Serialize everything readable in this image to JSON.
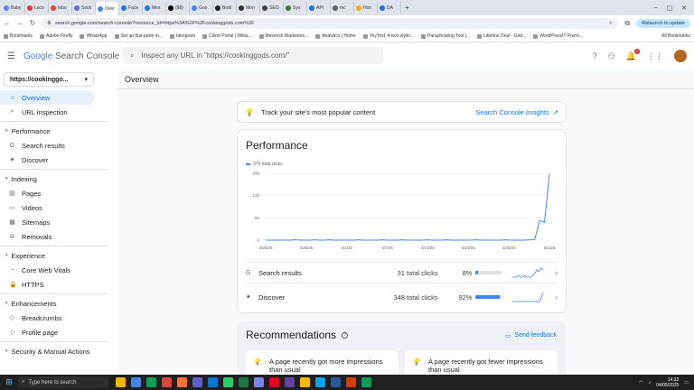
{
  "browser": {
    "tabs": [
      {
        "label": "Baby",
        "color": "#6b7ef5"
      },
      {
        "label": "Loco",
        "color": "#e53935"
      },
      {
        "label": "Inbo",
        "color": "#ea4335"
      },
      {
        "label": "Sock",
        "color": "#5b6ee1"
      },
      {
        "label": "Over",
        "color": "#4285f4",
        "active": true
      },
      {
        "label": "Face",
        "color": "#1877f2"
      },
      {
        "label": "Mes",
        "color": "#1877f2"
      },
      {
        "label": "(98)",
        "color": "#000000"
      },
      {
        "label": "Goo",
        "color": "#4285f4"
      },
      {
        "label": "Bodi",
        "color": "#222222"
      },
      {
        "label": "Mon",
        "color": "#333333"
      },
      {
        "label": "SEO",
        "color": "#444444"
      },
      {
        "label": "Sys",
        "color": "#2e7d32"
      },
      {
        "label": "API",
        "color": "#1a73e8"
      },
      {
        "label": "mc",
        "color": "#5f6368"
      },
      {
        "label": "Hon",
        "color": "#f9ab00"
      },
      {
        "label": "DA",
        "color": "#1a73e8"
      }
    ],
    "url": "search.google.com/search-console?resource_id=https%3A%2F%2Fcookinggods.com%2F",
    "relaunch": "Relaunch to update",
    "bookmarks": [
      "Bookmarks",
      "Adobe Firefly",
      "WhatsApp",
      "Set up first-party m...",
      "Ideogram",
      "Client Portal | Willia...",
      "Maverick Marketers...",
      "Analytics | Home",
      "YeyText: A text stylin...",
      "Paraphrasing Tool |...",
      "Lifetime Deal - Grid...",
      "WordPressIT Premi..."
    ],
    "all_bookmarks": "All Bookmarks"
  },
  "header": {
    "logo_google": "Google",
    "logo_product": "Search Console",
    "inspect_placeholder": "Inspect any URL in \"https://cookinggods.com/\"",
    "notif_count": "1"
  },
  "sidebar": {
    "property": "https://cookinggo...",
    "items": [
      {
        "type": "item",
        "label": "Overview",
        "icon": "⌂",
        "active": true,
        "name": "sidebar-item-overview"
      },
      {
        "type": "item",
        "label": "URL inspection",
        "icon": "⌕",
        "name": "sidebar-item-url-inspection"
      },
      {
        "type": "divider"
      },
      {
        "type": "section",
        "label": "Performance",
        "name": "sidebar-section-performance"
      },
      {
        "type": "item",
        "label": "Search results",
        "icon": "G",
        "name": "sidebar-item-search-results"
      },
      {
        "type": "item",
        "label": "Discover",
        "icon": "✷",
        "name": "sidebar-item-discover"
      },
      {
        "type": "divider"
      },
      {
        "type": "section",
        "label": "Indexing",
        "name": "sidebar-section-indexing"
      },
      {
        "type": "item",
        "label": "Pages",
        "icon": "▤",
        "name": "sidebar-item-pages"
      },
      {
        "type": "item",
        "label": "Videos",
        "icon": "▭",
        "name": "sidebar-item-videos"
      },
      {
        "type": "item",
        "label": "Sitemaps",
        "icon": "▦",
        "name": "sidebar-item-sitemaps"
      },
      {
        "type": "item",
        "label": "Removals",
        "icon": "⊘",
        "name": "sidebar-item-removals"
      },
      {
        "type": "divider"
      },
      {
        "type": "section",
        "label": "Experience",
        "name": "sidebar-section-experience"
      },
      {
        "type": "item",
        "label": "Core Web Vitals",
        "icon": "◔",
        "name": "sidebar-item-core-web-vitals"
      },
      {
        "type": "item",
        "label": "HTTPS",
        "icon": "🔒",
        "name": "sidebar-item-https"
      },
      {
        "type": "divider"
      },
      {
        "type": "section",
        "label": "Enhancements",
        "name": "sidebar-section-enhancements"
      },
      {
        "type": "item",
        "label": "Breadcrumbs",
        "icon": "◇",
        "name": "sidebar-item-breadcrumbs"
      },
      {
        "type": "item",
        "label": "Profile page",
        "icon": "◇",
        "name": "sidebar-item-profile-page"
      },
      {
        "type": "divider"
      },
      {
        "type": "section",
        "label": "Security & Manual Actions",
        "name": "sidebar-section-security"
      }
    ]
  },
  "main": {
    "title": "Overview",
    "insights": {
      "text": "Track your site's most popular content",
      "link": "Search Console Insights"
    },
    "performance": {
      "title": "Performance",
      "legend": "379 total clicks",
      "rows": [
        {
          "icon": "G",
          "name": "Search results",
          "clicks": "31 total clicks",
          "pct": "8%",
          "fraction": 0.08,
          "spark": [
            0,
            0,
            0,
            1,
            0,
            0,
            1,
            0,
            0,
            0,
            1,
            2,
            4,
            3,
            5,
            4
          ]
        },
        {
          "icon": "✷",
          "name": "Discover",
          "clicks": "348 total clicks",
          "pct": "92%",
          "fraction": 0.92,
          "spark": [
            0,
            0,
            0,
            0,
            0,
            0,
            0,
            0,
            0,
            0,
            0,
            0,
            0,
            0,
            2,
            9
          ]
        }
      ]
    },
    "recommendations": {
      "title": "Recommendations",
      "feedback": "Send feedback",
      "cards": [
        {
          "text": "A page recently got more impressions than usual"
        },
        {
          "text": "A page recently got fewer impressions than usual"
        }
      ]
    }
  },
  "chart_data": {
    "type": "line",
    "title": "",
    "xlabel": "",
    "ylabel": "",
    "series": [
      {
        "values": [
          0,
          0,
          0,
          0,
          0,
          0,
          1,
          0,
          0,
          0,
          1,
          0,
          0,
          1,
          0,
          0,
          0,
          0,
          0,
          1,
          0,
          0,
          0,
          0,
          1,
          0,
          0,
          0,
          1,
          0,
          0,
          0,
          0,
          1,
          0,
          0,
          0,
          1,
          0,
          0,
          0,
          0,
          0,
          1,
          0,
          0,
          0,
          0,
          0,
          1,
          0,
          0,
          0,
          0,
          1,
          2,
          53,
          48,
          178
        ]
      }
    ],
    "x_ticks": [
      "3/20/25",
      "3/25/25",
      "4/1/25",
      "4/7/25",
      "4/13/25",
      "4/19/25",
      "4/25/25",
      "5/1/25"
    ],
    "y_ticks": [
      0,
      60,
      120,
      180
    ],
    "ylim": [
      0,
      180
    ],
    "grid": true,
    "color": "#4285f4"
  },
  "taskbar": {
    "search_placeholder": "Type here to search",
    "time": "14:23",
    "date": "04/05/2025",
    "apps": [
      "#f4b400",
      "#4285f4",
      "#0f9d58",
      "#db4437",
      "#ff7139",
      "#5b5fc7",
      "#0078d4",
      "#25d366",
      "#217346",
      "#7b83eb",
      "#e60023",
      "#6441a5",
      "#ffb900",
      "#00a4ef",
      "#2b579a",
      "#d83b01",
      "#0f9d58"
    ]
  }
}
